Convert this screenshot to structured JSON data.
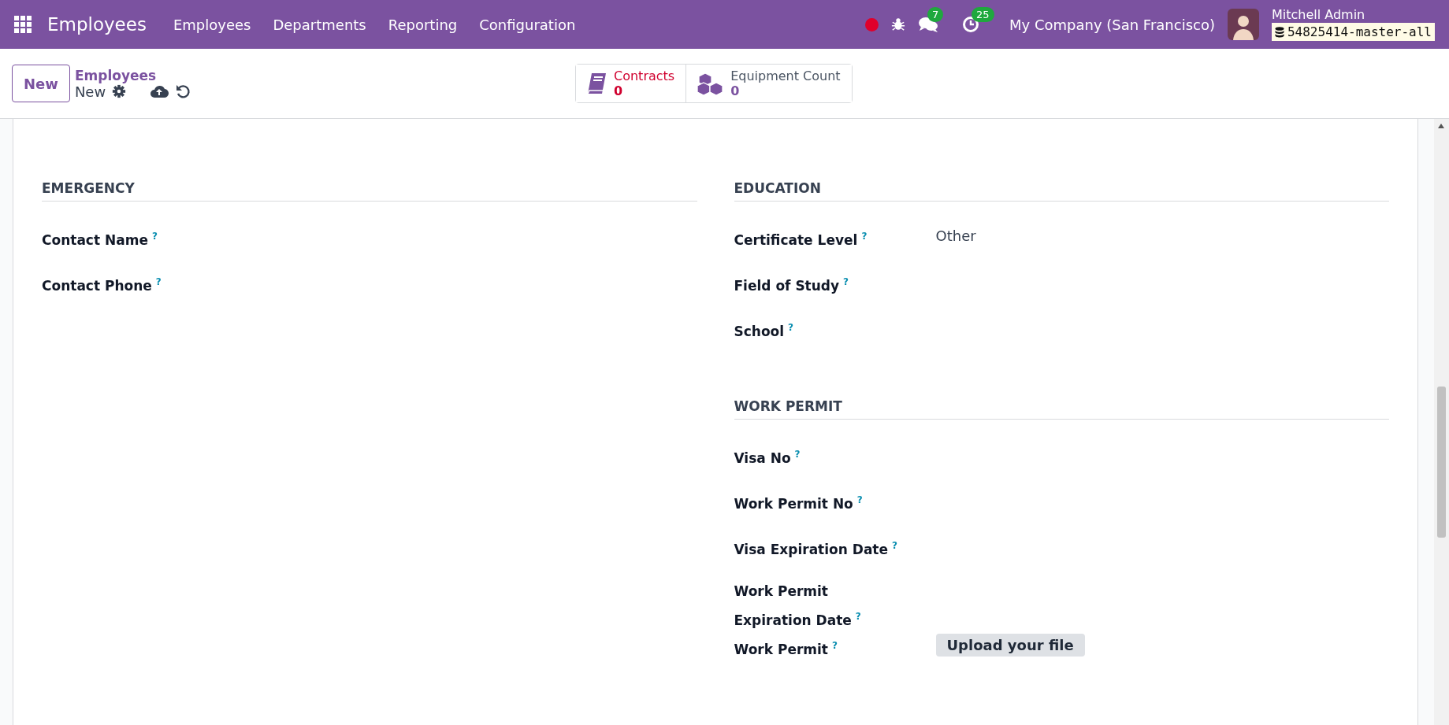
{
  "navbar": {
    "app_name": "Employees",
    "menu": [
      "Employees",
      "Departments",
      "Reporting",
      "Configuration"
    ],
    "messages_count": "7",
    "activities_count": "25",
    "company": "My Company (San Francisco)",
    "user": "Mitchell Admin",
    "database": "54825414-master-all"
  },
  "control_panel": {
    "new_button": "New",
    "breadcrumb": "Employees",
    "record": "New",
    "smart_buttons": [
      {
        "kind": "contracts",
        "label": "Contracts",
        "value": "0",
        "warning": true
      },
      {
        "kind": "equipment",
        "label": "Equipment Count",
        "value": "0",
        "warning": false
      }
    ]
  },
  "columns": [
    {
      "sections": [
        {
          "title": "EMERGENCY",
          "fields": [
            {
              "kind": "text",
              "label": "Contact Name",
              "help": "?"
            },
            {
              "kind": "text",
              "label": "Contact Phone",
              "help": "?"
            }
          ]
        }
      ]
    },
    {
      "sections": [
        {
          "title": "EDUCATION",
          "fields": [
            {
              "kind": "text",
              "label": "Certificate Level",
              "help": "?",
              "value": "Other"
            },
            {
              "kind": "text",
              "label": "Field of Study",
              "help": "?"
            },
            {
              "kind": "text",
              "label": "School",
              "help": "?"
            }
          ]
        },
        {
          "title": "WORK PERMIT",
          "fields": [
            {
              "kind": "text",
              "label": "Visa No",
              "help": "?"
            },
            {
              "kind": "text",
              "label": "Work Permit No",
              "help": "?"
            },
            {
              "kind": "text",
              "label": "Visa Expiration Date",
              "help": "?"
            },
            {
              "kind": "text",
              "label": "Work Permit Expiration Date",
              "help": "?"
            },
            {
              "kind": "file",
              "label": "Work Permit",
              "help": "?",
              "button": "Upload your file"
            }
          ]
        }
      ]
    }
  ]
}
